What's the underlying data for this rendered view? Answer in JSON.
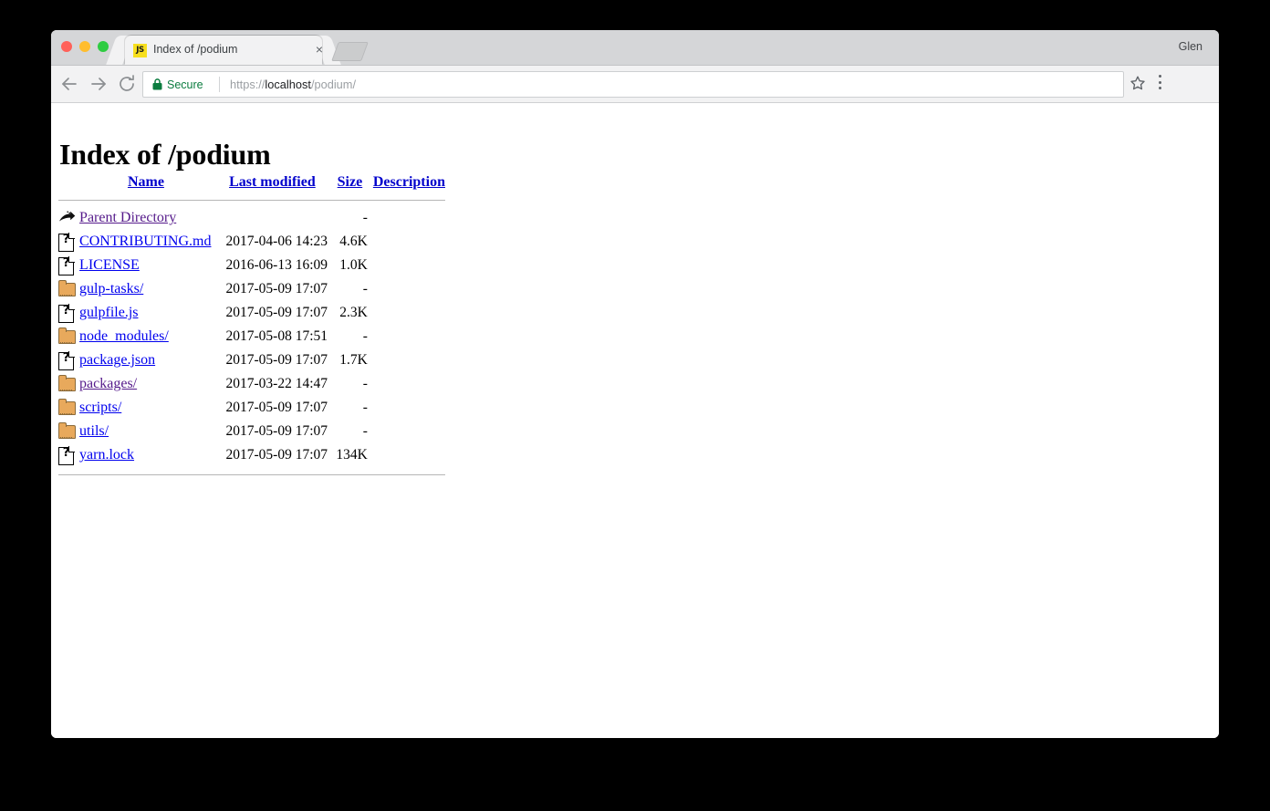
{
  "window": {
    "traffic_lights": [
      "close",
      "minimize",
      "maximize"
    ],
    "profile_name": "Glen"
  },
  "tab": {
    "favicon_label": "JS",
    "favicon_icon": "javascript-icon",
    "title": "Index of /podium",
    "close_label": "×",
    "new_tab_icon": "new-tab-icon"
  },
  "toolbar": {
    "back_icon": "back-arrow-icon",
    "forward_icon": "forward-arrow-icon",
    "reload_icon": "reload-icon",
    "security_icon": "lock-icon",
    "security_label": "Secure",
    "url_scheme": "https://",
    "url_host": "localhost",
    "url_path": "/podium/",
    "url_full": "https://localhost/podium/",
    "bookmark_icon": "star-icon",
    "menu_icon": "three-dot-menu-icon"
  },
  "page": {
    "title": "Index of /podium",
    "columns": [
      {
        "key": "name",
        "label": "Name"
      },
      {
        "key": "modified",
        "label": "Last modified"
      },
      {
        "key": "size",
        "label": "Size"
      },
      {
        "key": "description",
        "label": "Description"
      }
    ],
    "rows": [
      {
        "icon": "back-icon",
        "name": "Parent Directory",
        "modified": "",
        "size": "-",
        "description": "",
        "visited": true
      },
      {
        "icon": "unknown-file-icon",
        "name": "CONTRIBUTING.md",
        "modified": "2017-04-06 14:23",
        "size": "4.6K",
        "description": "",
        "visited": false
      },
      {
        "icon": "unknown-file-icon",
        "name": "LICENSE",
        "modified": "2016-06-13 16:09",
        "size": "1.0K",
        "description": "",
        "visited": false
      },
      {
        "icon": "folder-icon",
        "name": "gulp-tasks/",
        "modified": "2017-05-09 17:07",
        "size": "-",
        "description": "",
        "visited": false
      },
      {
        "icon": "unknown-file-icon",
        "name": "gulpfile.js",
        "modified": "2017-05-09 17:07",
        "size": "2.3K",
        "description": "",
        "visited": false
      },
      {
        "icon": "folder-icon",
        "name": "node_modules/",
        "modified": "2017-05-08 17:51",
        "size": "-",
        "description": "",
        "visited": false
      },
      {
        "icon": "unknown-file-icon",
        "name": "package.json",
        "modified": "2017-05-09 17:07",
        "size": "1.7K",
        "description": "",
        "visited": false
      },
      {
        "icon": "folder-icon",
        "name": "packages/",
        "modified": "2017-03-22 14:47",
        "size": "-",
        "description": "",
        "visited": true
      },
      {
        "icon": "folder-icon",
        "name": "scripts/",
        "modified": "2017-05-09 17:07",
        "size": "-",
        "description": "",
        "visited": false
      },
      {
        "icon": "folder-icon",
        "name": "utils/",
        "modified": "2017-05-09 17:07",
        "size": "-",
        "description": "",
        "visited": false
      },
      {
        "icon": "unknown-file-icon",
        "name": "yarn.lock",
        "modified": "2017-05-09 17:07",
        "size": "134K",
        "description": "",
        "visited": false
      }
    ]
  },
  "colors": {
    "link": "#0000ee",
    "link_visited": "#551a8b",
    "header_link": "#0000cc",
    "secure_green": "#0b7c3f",
    "folder": "#e8a95c",
    "favicon_yellow": "#f7df1e"
  }
}
